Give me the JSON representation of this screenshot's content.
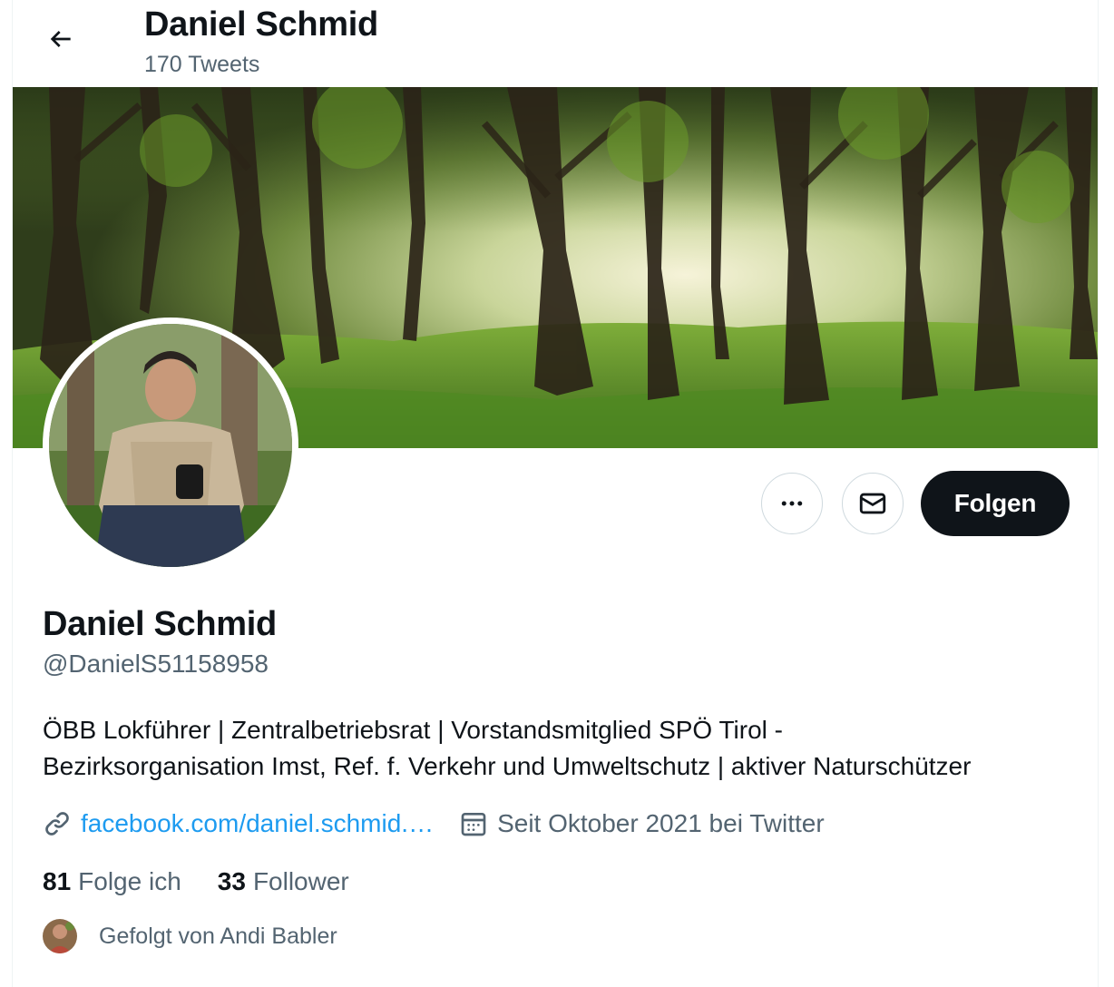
{
  "header": {
    "name": "Daniel Schmid",
    "tweet_count": "170 Tweets"
  },
  "actions": {
    "more_icon": "more-horizontal-icon",
    "message_icon": "envelope-icon",
    "follow_label": "Folgen"
  },
  "profile": {
    "name": "Daniel Schmid",
    "handle": "@DanielS51158958",
    "bio_line1": "ÖBB Lokführer | Zentralbetriebsrat | Vorstandsmitglied SPÖ Tirol -",
    "bio_line2": "Bezirksorganisation Imst, Ref. f. Verkehr und Umweltschutz | aktiver Naturschützer",
    "website": "facebook.com/daniel.schmid.…",
    "joined": "Seit Oktober 2021 bei Twitter"
  },
  "stats": {
    "following_count": "81",
    "following_label": "Folge ich",
    "followers_count": "33",
    "followers_label": "Follower"
  },
  "followed_by": {
    "text": "Gefolgt von Andi Babler"
  },
  "colors": {
    "accent": "#1d9bf0",
    "text_primary": "#0f1419",
    "text_secondary": "#536471",
    "follow_button_bg": "#0f1419"
  }
}
